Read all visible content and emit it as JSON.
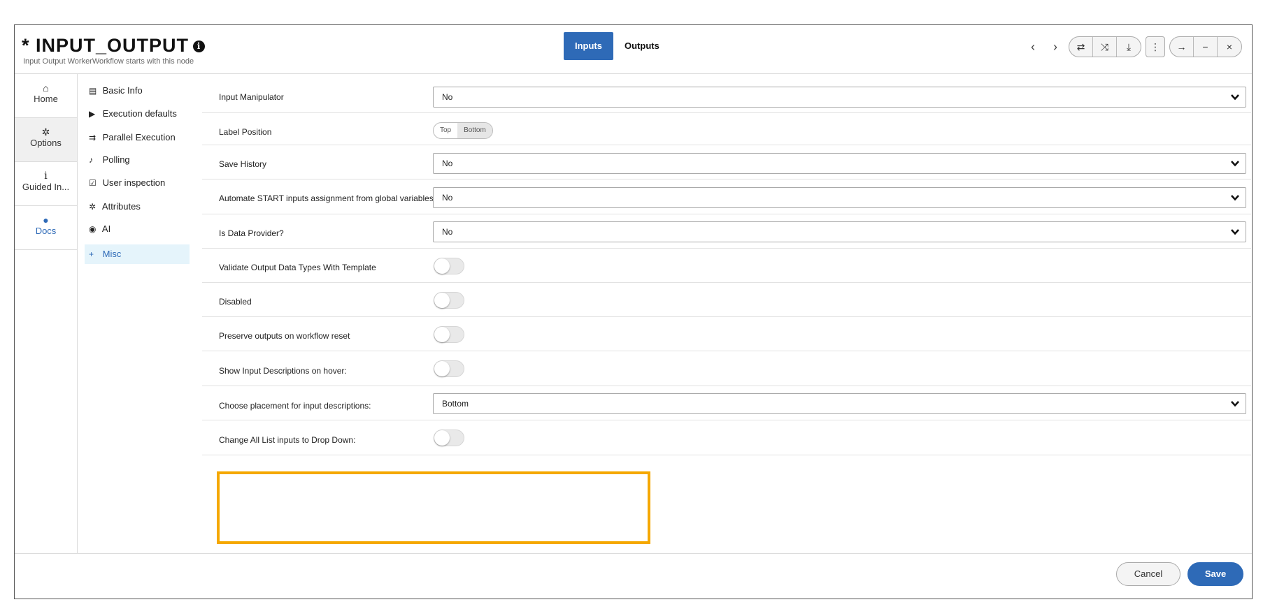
{
  "header": {
    "title": "* INPUT_OUTPUT",
    "info_glyph": "i",
    "subtitle": "Input Output WorkerWorkflow starts with this node",
    "tabs": [
      {
        "label": "Inputs",
        "active": true
      },
      {
        "label": "Outputs",
        "active": false
      }
    ],
    "tool_icons": [
      "prev-icon",
      "next-icon",
      "swap-icon",
      "shuffle-icon",
      "download-icon",
      "more-icon",
      "arrow-right-icon",
      "minimize-icon",
      "close-icon"
    ],
    "tool_glyphs": {
      "prev": "‹",
      "next": "›",
      "swap": "⇄",
      "shuffle": "⤨",
      "download": "⤓",
      "more": "⋮",
      "arrow": "→",
      "minimize": "−",
      "close": "×"
    }
  },
  "nav": {
    "items": [
      {
        "label": "Home",
        "icon": "home-icon",
        "glyph": "⌂"
      },
      {
        "label": "Options",
        "icon": "gear-icon",
        "glyph": "✲"
      },
      {
        "label": "Guided In...",
        "icon": "info-icon",
        "glyph": "i"
      },
      {
        "label": "Docs",
        "icon": "docs-icon",
        "glyph": "●"
      }
    ]
  },
  "submenu": {
    "items": [
      {
        "label": "Basic Info",
        "icon": "id-card-icon",
        "glyph": "▤"
      },
      {
        "label": "Execution defaults",
        "icon": "play-circle-icon",
        "glyph": "▶"
      },
      {
        "label": "Parallel Execution",
        "icon": "parallel-icon",
        "glyph": "⇉"
      },
      {
        "label": "Polling",
        "icon": "microphone-icon",
        "glyph": "♪"
      },
      {
        "label": "User inspection",
        "icon": "checkbox-icon",
        "glyph": "☑"
      },
      {
        "label": "Attributes",
        "icon": "cog-icon",
        "glyph": "✲"
      },
      {
        "label": "AI",
        "icon": "brain-icon",
        "glyph": "◉"
      },
      {
        "label": "Misc",
        "icon": "plus-icon",
        "glyph": "+",
        "selected": true
      }
    ]
  },
  "settings": {
    "input_manipulator": {
      "label": "Input Manipulator",
      "value": "No"
    },
    "label_position": {
      "label": "Label Position",
      "options": [
        "Top",
        "Bottom"
      ],
      "selected": "Bottom"
    },
    "save_history": {
      "label": "Save History",
      "value": "No"
    },
    "automate_start": {
      "label": "Automate START inputs assignment from global variables",
      "value": "No"
    },
    "is_data_provider": {
      "label": "Is Data Provider?",
      "value": "No"
    },
    "validate_output": {
      "label": "Validate Output Data Types With Template",
      "on": false
    },
    "disabled": {
      "label": "Disabled",
      "on": false
    },
    "preserve_outputs": {
      "label": "Preserve outputs on workflow reset",
      "on": false
    },
    "show_descriptions": {
      "label": "Show Input Descriptions on hover:",
      "on": false
    },
    "placement": {
      "label": "Choose placement for input descriptions:",
      "value": "Bottom"
    },
    "change_list": {
      "label": "Change All List inputs to Drop Down:",
      "on": false
    }
  },
  "footer": {
    "cancel_label": "Cancel",
    "save_label": "Save"
  },
  "colors": {
    "accent": "#2e6ab7",
    "highlight": "#f5a800"
  }
}
